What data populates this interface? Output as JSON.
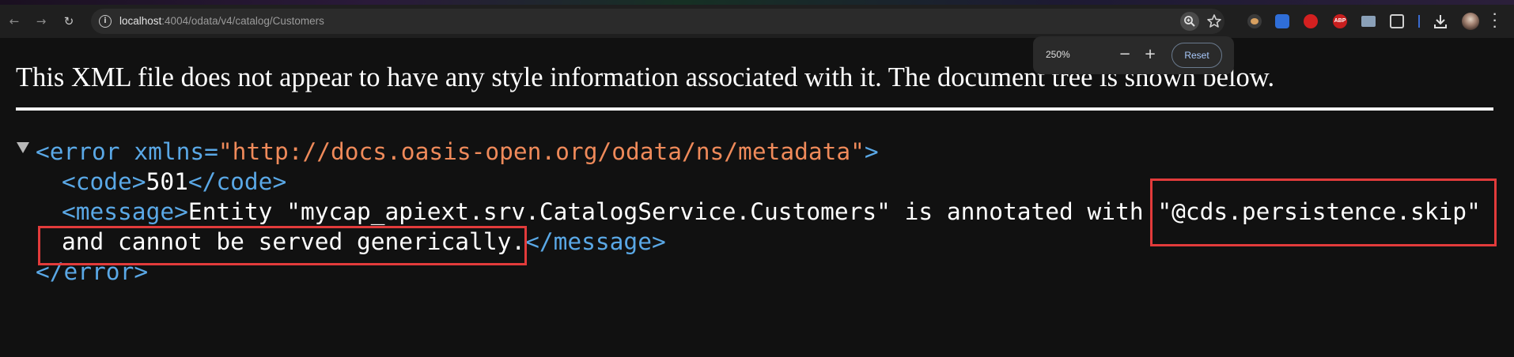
{
  "browser": {
    "url_host": "localhost",
    "url_rest": ":4004/odata/v4/catalog/Customers",
    "nav_icons": [
      "back-arrow-icon",
      "forward-arrow-icon",
      "reload-icon"
    ],
    "extension_icons": [
      "cookie-extension-icon",
      "blue-extension-icon",
      "red-extension-icon",
      "adblock-extension-icon",
      "card-extension-icon",
      "puzzle-extensions-icon"
    ],
    "accent_color": "#3a6cd0"
  },
  "zoom_popup": {
    "level": "250%",
    "minus": "−",
    "plus": "+",
    "reset_label": "Reset"
  },
  "xml_viewer": {
    "info": "This XML file does not appear to have any style information associated with it. The document tree is shown below.",
    "toggle_icon": "collapse-triangle-icon",
    "error_open": "<error",
    "xmlns_attr": "xmlns=",
    "xmlns_value": "\"http://docs.oasis-open.org/odata/ns/metadata\"",
    "error_open_end": ">",
    "code_open": "<code>",
    "code_value": "501",
    "code_close": "</code>",
    "message_open": "<message>",
    "message_text_1": "Entity \"mycap_apiext.srv.CatalogService.Customers\" is annotated with \"@cds.persistence.skip\"",
    "message_text_2": "and cannot be served generically.",
    "message_close": "</message>",
    "error_close": "</error>"
  },
  "annotation_color": "#e23b3b"
}
